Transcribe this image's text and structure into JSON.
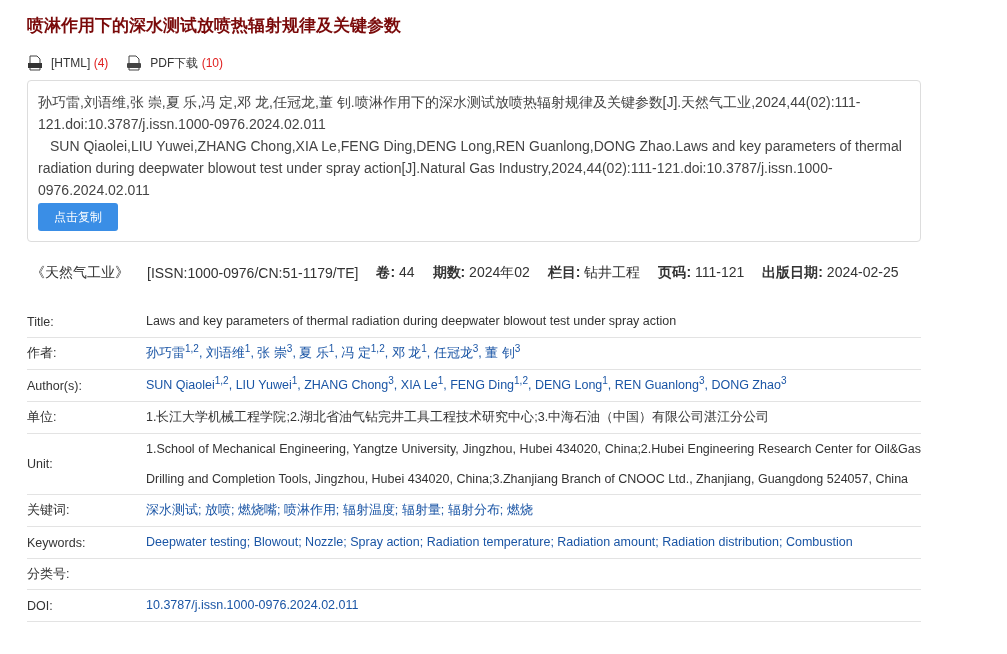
{
  "title": "喷淋作用下的深水测试放喷热辐射规律及关键参数",
  "downloads": [
    {
      "kind": "html",
      "label": "[HTML]",
      "count": "(4)"
    },
    {
      "kind": "pdf",
      "label": "PDF下载",
      "count": "(10)"
    }
  ],
  "citation": {
    "chinese": "孙巧雷,刘语维,张 崇,夏 乐,冯 定,邓 龙,任冠龙,董 钊.喷淋作用下的深水测试放喷热辐射规律及关键参数[J].天然气工业,2024,44(02):111-121.doi:10.3787/j.issn.1000-0976.2024.02.011",
    "english": "SUN Qiaolei,LIU Yuwei,ZHANG Chong,XIA Le,FENG Ding,DENG Long,REN Guanlong,DONG Zhao.Laws and key parameters of thermal radiation during deepwater blowout test under spray action[J].Natural Gas Industry,2024,44(02):111-121.doi:10.3787/j.issn.1000-0976.2024.02.011",
    "copy_button": "点击复制"
  },
  "info": {
    "journal": "《天然气工业》",
    "issn": "[ISSN:1000-0976/CN:51-1179/TE]",
    "items": [
      {
        "label": "卷:",
        "value": "44"
      },
      {
        "label": "期数:",
        "value": "2024年02"
      },
      {
        "label": "栏目:",
        "value": "钻井工程"
      },
      {
        "label": "页码:",
        "value": "111-121"
      },
      {
        "label": "出版日期:",
        "value": "2024-02-25"
      }
    ]
  },
  "rows": [
    {
      "label": "Title:",
      "kind": "text",
      "value": "Laws and key parameters of thermal radiation during deepwater blowout test under spray action"
    },
    {
      "label": "作者:",
      "kind": "link",
      "value": "孙巧雷$^{1,2}$, 刘语维$^{1}$, 张 崇$^{3}$, 夏 乐$^{1}$, 冯 定$^{1,2}$, 邓 龙$^{1}$, 任冠龙$^{3}$, 董 钊$^{3}$"
    },
    {
      "label": "Author(s):",
      "kind": "link",
      "value": "SUN Qiaolei$^{1,2}$, LIU Yuwei$^{1}$, ZHANG Chong$^{3}$, XIA Le$^{1}$, FENG Ding$^{1,2}$, DENG Long$^{1}$, REN Guanlong$^{3}$, DONG Zhao$^{3}$"
    },
    {
      "label": "单位:",
      "kind": "text",
      "value": "1.长江大学机械工程学院;2.湖北省油气钻完井工具工程技术研究中心;3.中海石油（中国）有限公司湛江分公司"
    },
    {
      "label": "Unit:",
      "kind": "para",
      "value": "1.School of Mechanical Engineering, Yangtze University, Jingzhou, Hubei 434020, China;2.Hubei Engineering Research Center for Oil&Gas Drilling and Completion Tools, Jingzhou, Hubei 434020, China;3.Zhanjiang Branch of CNOOC Ltd., Zhanjiang, Guangdong 524057, China"
    },
    {
      "label": "关键词:",
      "kind": "link",
      "value": "深水测试; 放喷; 燃烧嘴; 喷淋作用; 辐射温度; 辐射量; 辐射分布; 燃烧"
    },
    {
      "label": "Keywords:",
      "kind": "link",
      "value": "Deepwater testing; Blowout; Nozzle; Spray action; Radiation temperature; Radiation amount; Radiation distribution; Combustion"
    },
    {
      "label": "分类号:",
      "kind": "empty"
    },
    {
      "label": "DOI:",
      "kind": "link",
      "value": "10.3787/j.issn.1000-0976.2024.02.011"
    }
  ]
}
